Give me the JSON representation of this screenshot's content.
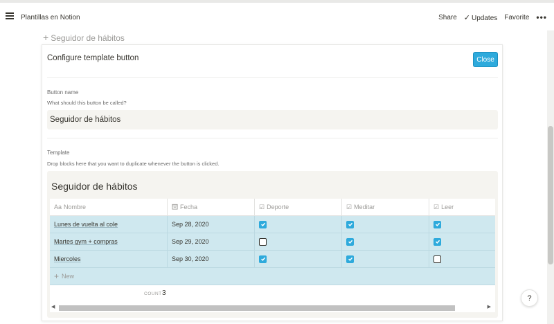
{
  "topbar": {
    "workspace_title": "Plantillas en Notion",
    "share_label": "Share",
    "updates_label": "Updates",
    "favorite_label": "Favorite",
    "more_label": "•••"
  },
  "page": {
    "add_button_label": "Seguidor de hábitos"
  },
  "panel": {
    "title": "Configure template button",
    "close_label": "Close",
    "button_name_label": "Button name",
    "button_name_help": "What should this button be called?",
    "button_name_value": "Seguidor de hábitos",
    "template_label": "Template",
    "template_help": "Drop blocks here that you want to duplicate whenever the button is clicked."
  },
  "database": {
    "title": "Seguidor de hábitos",
    "columns": [
      {
        "label": "Nombre",
        "icon": "Aa"
      },
      {
        "label": "Fecha",
        "icon": "calendar-icon"
      },
      {
        "label": "Deporte",
        "icon": "checkbox-icon"
      },
      {
        "label": "Meditar",
        "icon": "checkbox-icon"
      },
      {
        "label": "Leer",
        "icon": "checkbox-icon"
      }
    ],
    "rows": [
      {
        "name": "Lunes de vuelta al cole",
        "date": "Sep 28, 2020",
        "deporte": true,
        "meditar": true,
        "leer": true
      },
      {
        "name": "Martes gym + compras",
        "date": "Sep 29, 2020",
        "deporte": false,
        "meditar": true,
        "leer": true
      },
      {
        "name": "Miercoles",
        "date": "Sep 30, 2020",
        "deporte": true,
        "meditar": true,
        "leer": false
      }
    ],
    "new_label": "New",
    "count_label": "COUNT",
    "count_value": "3"
  },
  "help": {
    "label": "?"
  },
  "colors": {
    "accent": "#2eaadc",
    "row_highlight": "#cfe8ef",
    "template_bg": "#f5f4f0"
  }
}
